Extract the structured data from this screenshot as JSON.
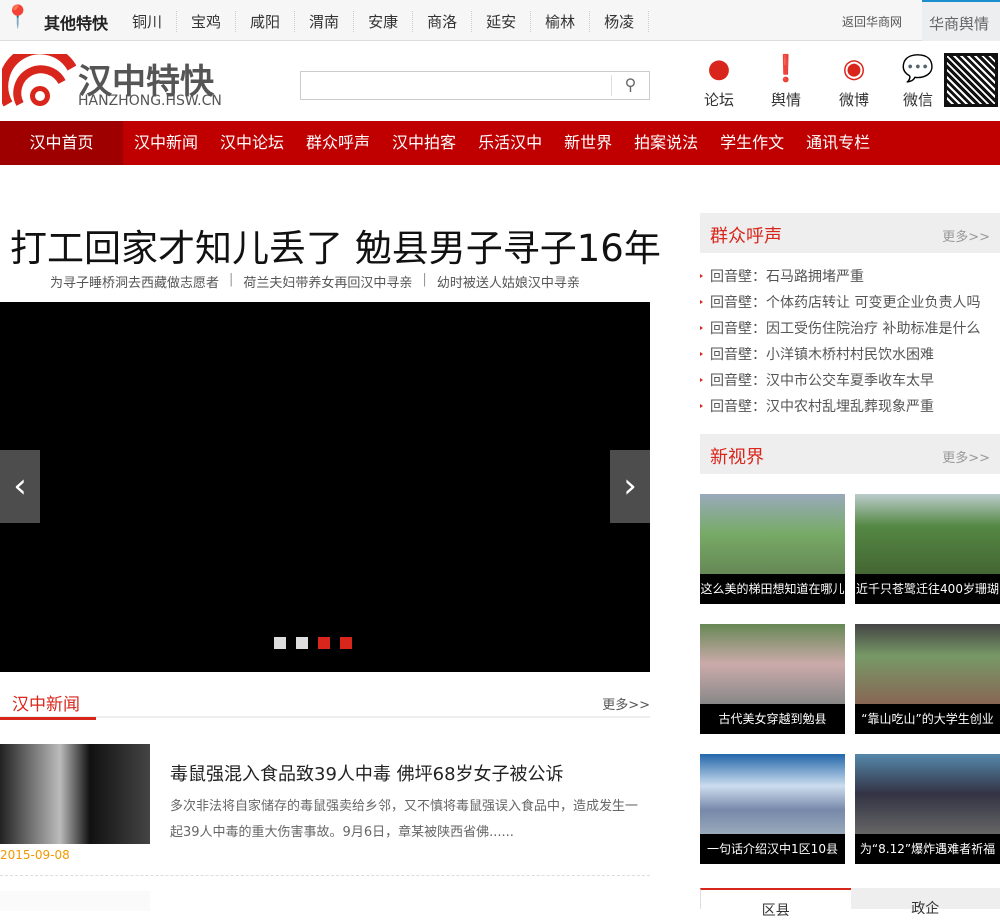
{
  "topbar": {
    "other_label": "其他特快",
    "cities": [
      "铜川",
      "宝鸡",
      "咸阳",
      "渭南",
      "安康",
      "商洛",
      "延安",
      "榆林",
      "杨凌"
    ],
    "back_link": "返回华商网",
    "hsyq": "华商舆情"
  },
  "logo": {
    "name": "汉中特快",
    "domain": "HANZHONG.HSW.CN"
  },
  "search": {
    "value": "",
    "placeholder": ""
  },
  "header_icons": [
    {
      "label": "论坛",
      "icon": "person-icon"
    },
    {
      "label": "舆情",
      "icon": "alert-icon"
    },
    {
      "label": "微博",
      "icon": "weibo-icon"
    },
    {
      "label": "微信",
      "icon": "wechat-icon"
    }
  ],
  "nav": [
    "汉中首页",
    "汉中新闻",
    "汉中论坛",
    "群众呼声",
    "汉中拍客",
    "乐活汉中",
    "新世界",
    "拍案说法",
    "学生作文",
    "通讯专栏"
  ],
  "headline": {
    "title": "打工回家才知儿丢了 勉县男子寻子16年",
    "subs": [
      "为寻子睡桥洞去西藏做志愿者",
      "荷兰夫妇带养女再回汉中寻亲",
      "幼时被送人姑娘汉中寻亲"
    ]
  },
  "slider": {
    "dots": 4,
    "active": [
      2,
      3
    ]
  },
  "news": {
    "title": "汉中新闻",
    "more": "更多>>",
    "item": {
      "title": "毒鼠强混入食品致39人中毒 佛坪68岁女子被公诉",
      "desc": "多次非法将自家储存的毒鼠强卖给乡邻，又不慎将毒鼠强误入食品中，造成发生一起39人中毒的重大伤害事故。9月6日，章某被陕西省佛......",
      "date": "2015-09-08"
    }
  },
  "voice": {
    "title": "群众呼声",
    "more": "更多>>",
    "items": [
      "回音壁：石马路拥堵严重",
      "回音壁：个体药店转让 可变更企业负责人吗",
      "回音壁：因工受伤住院治疗 补助标准是什么",
      "回音壁：小洋镇木桥村村民饮水困难",
      "回音壁：汉中市公交车夏季收车太早",
      "回音壁：汉中农村乱埋乱葬现象严重"
    ]
  },
  "vision": {
    "title": "新视界",
    "more": "更多>>",
    "pics": [
      "这么美的梯田想知道在哪儿",
      "近千只苍鹭迁往400岁珊瑚",
      "古代美女穿越到勉县",
      "“靠山吃山”的大学生创业",
      "一句话介绍汉中1区10县",
      "为“8.12”爆炸遇难者祈福"
    ]
  },
  "tabs": [
    "区县",
    "政企"
  ]
}
